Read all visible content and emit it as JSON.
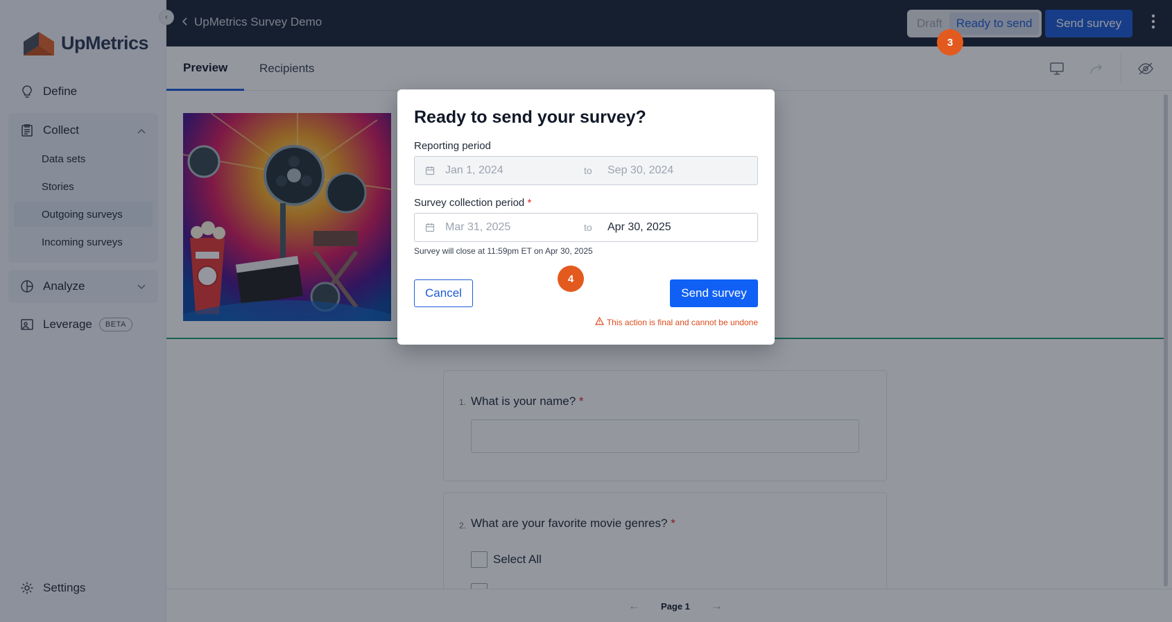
{
  "sidebar": {
    "logo_text": "UpMetrics",
    "items": {
      "define": "Define",
      "collect": "Collect",
      "analyze": "Analyze",
      "leverage": "Leverage",
      "leverage_badge": "BETA",
      "settings": "Settings"
    },
    "collect_children": [
      "Data sets",
      "Stories",
      "Outgoing surveys",
      "Incoming surveys"
    ],
    "active_child": "Outgoing surveys"
  },
  "topbar": {
    "back_label": "UpMetrics Survey Demo",
    "status_options": [
      "Draft",
      "Ready to send"
    ],
    "status_selected": "Ready to send",
    "send_label": "Send survey"
  },
  "tabs": [
    "Preview",
    "Recipients"
  ],
  "questions": [
    {
      "num": "1.",
      "text": "What is your name?"
    },
    {
      "num": "2.",
      "text": "What are your favorite movie genres?",
      "option": "Select All"
    }
  ],
  "footer": {
    "page_label": "Page 1"
  },
  "modal": {
    "title": "Ready to send your survey?",
    "reporting_label": "Reporting period",
    "reporting_start": "Jan 1, 2024",
    "reporting_end": "Sep 30, 2024",
    "collection_label": "Survey collection period",
    "collection_start": "Mar 31, 2025",
    "collection_end": "Apr 30, 2025",
    "to_label": "to",
    "note": "Survey will close at 11:59pm ET on Apr 30, 2025",
    "cancel_label": "Cancel",
    "send_label": "Send survey",
    "warning": "This action is final and cannot be undone"
  },
  "badges": {
    "step3": "3",
    "step4": "4"
  },
  "colors": {
    "brand_blue": "#1d5bd8",
    "nav_dark": "#1b2538",
    "badge_orange": "#e35a1f",
    "warning": "#dc4a1c"
  }
}
